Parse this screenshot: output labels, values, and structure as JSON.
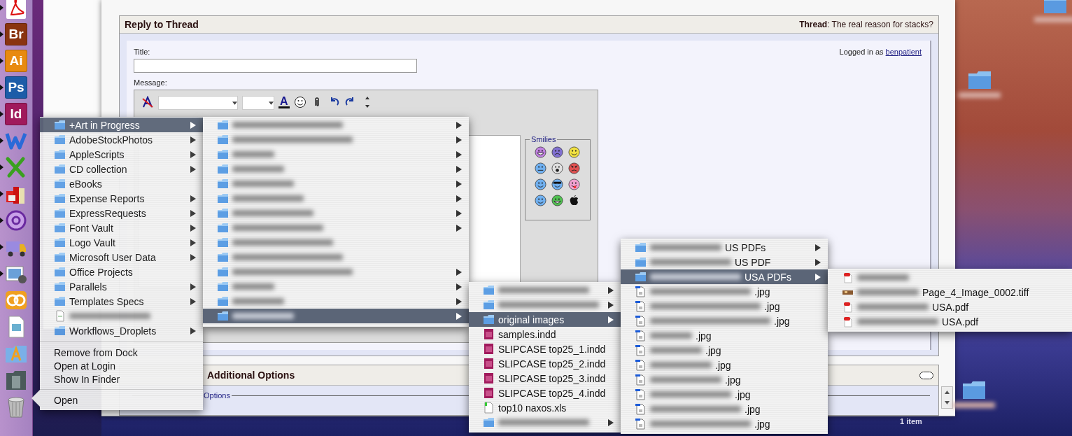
{
  "dock": {
    "items": [
      {
        "kind": "pdf",
        "running": true
      },
      {
        "kind": "letter",
        "label": "Br",
        "color": "#8a3410",
        "running": true
      },
      {
        "kind": "letter",
        "label": "Ai",
        "color": "#e88a10",
        "running": true
      },
      {
        "kind": "letter",
        "label": "Ps",
        "color": "#1c5ca8",
        "running": true
      },
      {
        "kind": "letter",
        "label": "Id",
        "color": "#a01a5c",
        "running": true
      },
      {
        "kind": "word",
        "running": true
      },
      {
        "kind": "excel",
        "running": true
      },
      {
        "kind": "books",
        "running": true
      },
      {
        "kind": "mail",
        "running": true
      },
      {
        "kind": "truck",
        "running": true
      },
      {
        "kind": "photo",
        "running": true
      },
      {
        "kind": "rings",
        "running": false
      },
      {
        "kind": "doc",
        "running": false
      },
      {
        "kind": "apps",
        "running": false
      },
      {
        "kind": "stack",
        "running": false
      },
      {
        "kind": "trash",
        "running": false
      }
    ]
  },
  "browser": {
    "reply": {
      "title": "Reply to Thread",
      "thread": "**Thread**: The real reason for stacks?",
      "logged_in": "Logged in as",
      "user": "benpatient",
      "title_label": "Title:",
      "message_label": "Message:",
      "toolbar": [
        {
          "kind": "clear"
        },
        {
          "kind": "font-select"
        },
        {
          "kind": "size-select"
        },
        {
          "kind": "color",
          "label": "A"
        },
        {
          "kind": "smiley"
        },
        {
          "kind": "clip"
        },
        {
          "kind": "undo"
        },
        {
          "kind": "redo"
        },
        {
          "kind": "resize"
        }
      ],
      "smilies_label": "Smilies",
      "smilies": [
        {
          "kind": "grin",
          "color": "#c080e0"
        },
        {
          "kind": "frown",
          "color": "#8070d0"
        },
        {
          "kind": "smile",
          "color": "#f0e040"
        },
        {
          "kind": "confused",
          "color": "#70b0f0"
        },
        {
          "kind": "shock",
          "color": "#e0e0e0"
        },
        {
          "kind": "mad",
          "color": "#e05050"
        },
        {
          "kind": "smile",
          "color": "#70b0f0"
        },
        {
          "kind": "cool",
          "color": "#70b0f0"
        },
        {
          "kind": "tongue",
          "color": "#f0a0d0"
        },
        {
          "kind": "smile",
          "color": "#70b0f0"
        },
        {
          "kind": "grin",
          "color": "#50c050"
        },
        {
          "kind": "apple",
          "color": "#111111"
        }
      ]
    },
    "additional": {
      "title": "Additional Options",
      "legend": "Options"
    }
  },
  "desktop": {
    "icons": [
      {
        "kind": "folder"
      },
      {
        "kind": "folder"
      },
      {
        "kind": "folder"
      }
    ],
    "stack_label": "1 item"
  },
  "menus": [
    {
      "items": [
        {
          "kind": "folder",
          "label": "+Art in Progress",
          "submenu": true,
          "selected": true
        },
        {
          "kind": "folder",
          "label": "AdobeStockPhotos",
          "submenu": true,
          "selected": false
        },
        {
          "kind": "folder",
          "label": "AppleScripts",
          "submenu": true,
          "selected": false
        },
        {
          "kind": "folder",
          "label": "CD collection",
          "submenu": true,
          "selected": false
        },
        {
          "kind": "folder",
          "label": "eBooks",
          "submenu": false,
          "selected": false
        },
        {
          "kind": "folder",
          "label": "Expense Reports",
          "submenu": true,
          "selected": false
        },
        {
          "kind": "folder",
          "label": "ExpressRequests",
          "submenu": true,
          "selected": false
        },
        {
          "kind": "folder",
          "label": "Font Vault",
          "submenu": true,
          "selected": false
        },
        {
          "kind": "folder",
          "label": "Logo Vault",
          "submenu": true,
          "selected": false
        },
        {
          "kind": "folder",
          "label": "Microsoft User Data",
          "submenu": true,
          "selected": false
        },
        {
          "kind": "folder",
          "label": "Office Projects",
          "submenu": false,
          "selected": false
        },
        {
          "kind": "folder",
          "label": "Parallels",
          "submenu": true,
          "selected": false
        },
        {
          "kind": "folder",
          "label": "Templates Specs",
          "submenu": true,
          "selected": false
        },
        {
          "kind": "file",
          "blurred": true,
          "submenu": false,
          "selected": false
        },
        {
          "kind": "folder",
          "label": "Workflows_Droplets",
          "submenu": true,
          "selected": false
        },
        {
          "kind": "separator"
        },
        {
          "kind": "command",
          "label": "Remove from Dock"
        },
        {
          "kind": "command",
          "label": "Open at Login"
        },
        {
          "kind": "command",
          "label": "Show In Finder"
        },
        {
          "kind": "separator"
        },
        {
          "kind": "command",
          "label": "Open"
        }
      ]
    },
    {
      "items": [
        {
          "kind": "folder",
          "blurred": true,
          "submenu": true,
          "selected": false
        },
        {
          "kind": "folder",
          "blurred": true,
          "submenu": true,
          "selected": false
        },
        {
          "kind": "folder",
          "blurred": true,
          "submenu": true,
          "selected": false
        },
        {
          "kind": "folder",
          "blurred": true,
          "submenu": true,
          "selected": false
        },
        {
          "kind": "folder",
          "blurred": true,
          "submenu": true,
          "selected": false
        },
        {
          "kind": "folder",
          "blurred": true,
          "submenu": true,
          "selected": false
        },
        {
          "kind": "folder",
          "blurred": true,
          "submenu": true,
          "selected": false
        },
        {
          "kind": "folder",
          "blurred": true,
          "submenu": true,
          "selected": false
        },
        {
          "kind": "folder",
          "blurred": true,
          "submenu": false,
          "selected": false
        },
        {
          "kind": "folder",
          "blurred": true,
          "submenu": false,
          "selected": false
        },
        {
          "kind": "folder",
          "blurred": true,
          "submenu": true,
          "selected": false
        },
        {
          "kind": "folder",
          "blurred": true,
          "submenu": true,
          "selected": false
        },
        {
          "kind": "folder",
          "blurred": true,
          "submenu": true,
          "selected": false
        },
        {
          "kind": "folder",
          "blurred": true,
          "submenu": true,
          "selected": true
        }
      ]
    },
    {
      "items": [
        {
          "kind": "folder",
          "blurred": true,
          "submenu": true,
          "selected": false
        },
        {
          "kind": "folder",
          "blurred": true,
          "submenu": true,
          "selected": false
        },
        {
          "kind": "folder",
          "label": "original images",
          "submenu": true,
          "selected": true
        },
        {
          "kind": "indd",
          "label": "samples.indd",
          "submenu": false,
          "selected": false
        },
        {
          "kind": "indd",
          "label": "SLIPCASE top25_1.indd",
          "submenu": false,
          "selected": false
        },
        {
          "kind": "indd",
          "label": "SLIPCASE top25_2.indd",
          "submenu": false,
          "selected": false
        },
        {
          "kind": "indd",
          "label": "SLIPCASE top25_3.indd",
          "submenu": false,
          "selected": false
        },
        {
          "kind": "indd",
          "label": "SLIPCASE top25_4.indd",
          "submenu": false,
          "selected": false
        },
        {
          "kind": "xls",
          "label": "top10 naxos.xls",
          "submenu": false,
          "selected": false
        },
        {
          "kind": "folder",
          "blurred": true,
          "submenu": true,
          "selected": false
        }
      ]
    },
    {
      "items": [
        {
          "kind": "folder",
          "blurred": true,
          "label": "US PDFs",
          "submenu": true,
          "selected": false
        },
        {
          "kind": "folder",
          "blurred": true,
          "label": "US PDF",
          "submenu": true,
          "selected": false
        },
        {
          "kind": "folder",
          "blurred": true,
          "label": "USA PDFs",
          "submenu": true,
          "selected": true
        },
        {
          "kind": "jpg",
          "blurred": true,
          "label": ".jpg",
          "submenu": false,
          "selected": false
        },
        {
          "kind": "jpg",
          "blurred": true,
          "label": ".jpg",
          "submenu": false,
          "selected": false
        },
        {
          "kind": "jpg",
          "blurred": true,
          "label": ".jpg",
          "submenu": false,
          "selected": false
        },
        {
          "kind": "jpg",
          "blurred": true,
          "label": ".jpg",
          "submenu": false,
          "selected": false
        },
        {
          "kind": "jpg",
          "blurred": true,
          "label": ".jpg",
          "submenu": false,
          "selected": false
        },
        {
          "kind": "jpg",
          "blurred": true,
          "label": ".jpg",
          "submenu": false,
          "selected": false
        },
        {
          "kind": "jpg",
          "blurred": true,
          "label": ".jpg",
          "submenu": false,
          "selected": false
        },
        {
          "kind": "jpg",
          "blurred": true,
          "label": ".jpg",
          "submenu": false,
          "selected": false
        },
        {
          "kind": "jpg",
          "blurred": true,
          "label": ".jpg",
          "submenu": false,
          "selected": false
        },
        {
          "kind": "jpg",
          "blurred": true,
          "label": ".jpg",
          "submenu": false,
          "selected": false
        }
      ]
    },
    {
      "items": [
        {
          "kind": "pdf",
          "blurred": true,
          "submenu": false,
          "selected": false
        },
        {
          "kind": "tiff",
          "blurred": true,
          "label": "Page_4_Image_0002.tiff",
          "submenu": false,
          "selected": false
        },
        {
          "kind": "pdf",
          "blurred": true,
          "label": "USA.pdf",
          "submenu": false,
          "selected": false
        },
        {
          "kind": "pdf",
          "blurred": true,
          "label": "USA.pdf",
          "submenu": false,
          "selected": false
        }
      ]
    }
  ]
}
